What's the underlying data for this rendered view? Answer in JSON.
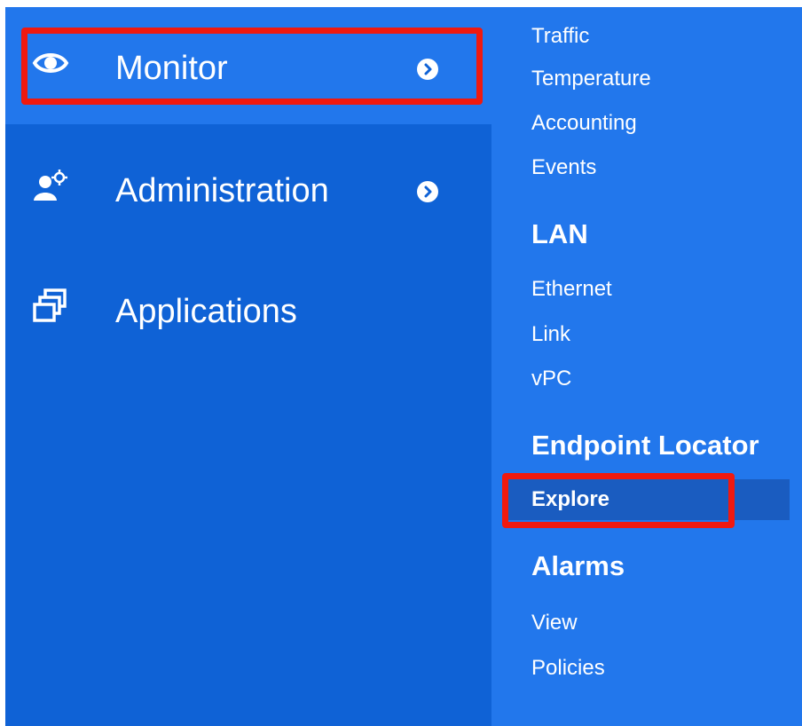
{
  "nav": {
    "items": [
      {
        "label": "Monitor",
        "icon": "eye-icon",
        "has_submenu": true,
        "active": true
      },
      {
        "label": "Administration",
        "icon": "user-gear-icon",
        "has_submenu": true,
        "active": false
      },
      {
        "label": "Applications",
        "icon": "windows-stack-icon",
        "has_submenu": false,
        "active": false
      }
    ]
  },
  "submenu": {
    "top_links": [
      "Traffic",
      "Temperature",
      "Accounting",
      "Events"
    ],
    "sections": [
      {
        "heading": "LAN",
        "links": [
          "Ethernet",
          "Link",
          "vPC"
        ]
      },
      {
        "heading": "Endpoint Locator",
        "links": [
          "Explore"
        ]
      },
      {
        "heading": "Alarms",
        "links": [
          "View",
          "Policies"
        ]
      }
    ],
    "selected": "Explore"
  },
  "colors": {
    "nav_bg": "#0f62d6",
    "active_bg": "#2277ec",
    "submenu_bg": "#2277ec",
    "selected_bg": "#1a5cc0",
    "highlight": "#f0190f",
    "text": "#ffffff"
  }
}
